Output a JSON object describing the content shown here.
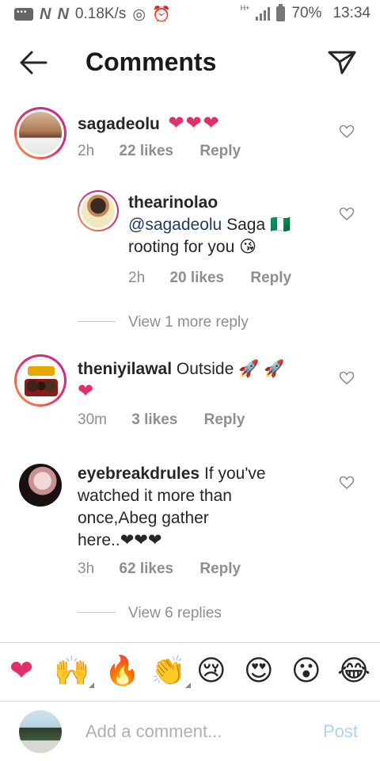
{
  "status_bar": {
    "network_speed": "0.18K/s",
    "network_type": "H+",
    "battery": "70%",
    "time": "13:34",
    "notification_badges": [
      "N",
      "N"
    ]
  },
  "header": {
    "title": "Comments",
    "back_icon": "arrow-left-icon",
    "send_icon": "paper-plane-icon"
  },
  "comments": [
    {
      "username": "sagadeolu",
      "text": "❤❤❤",
      "time": "2h",
      "likes": "22 likes",
      "reply_label": "Reply",
      "replies": [
        {
          "username": "thearinolao",
          "mention": "@sagadeolu",
          "text_line1": "Saga 🇳🇬",
          "text_line2": "rooting for you 😘",
          "time": "2h",
          "likes": "20 likes",
          "reply_label": "Reply"
        }
      ],
      "view_more": "View 1 more reply"
    },
    {
      "username": "theniyilawal",
      "text": "Outside 🚀 🚀",
      "text_line2": "❤",
      "time": "30m",
      "likes": "3 likes",
      "reply_label": "Reply"
    },
    {
      "username": "eyebreakdrules",
      "text": "If you've",
      "text_line2": "watched it more than",
      "text_line3": "once,Abeg gather",
      "text_line4": "here..❤❤❤",
      "time": "3h",
      "likes": "62 likes",
      "reply_label": "Reply",
      "view_more": "View 6 replies"
    }
  ],
  "emoji_bar": [
    "❤",
    "🙌",
    "🔥",
    "👏",
    "😢",
    "😍",
    "😮",
    "😂"
  ],
  "composer": {
    "placeholder": "Add a comment...",
    "post_label": "Post"
  },
  "colors": {
    "accent_pink": "#e0306a",
    "post_disabled": "#a8d4f5",
    "muted": "#8e8e8e",
    "mention": "#1e3a6e"
  }
}
